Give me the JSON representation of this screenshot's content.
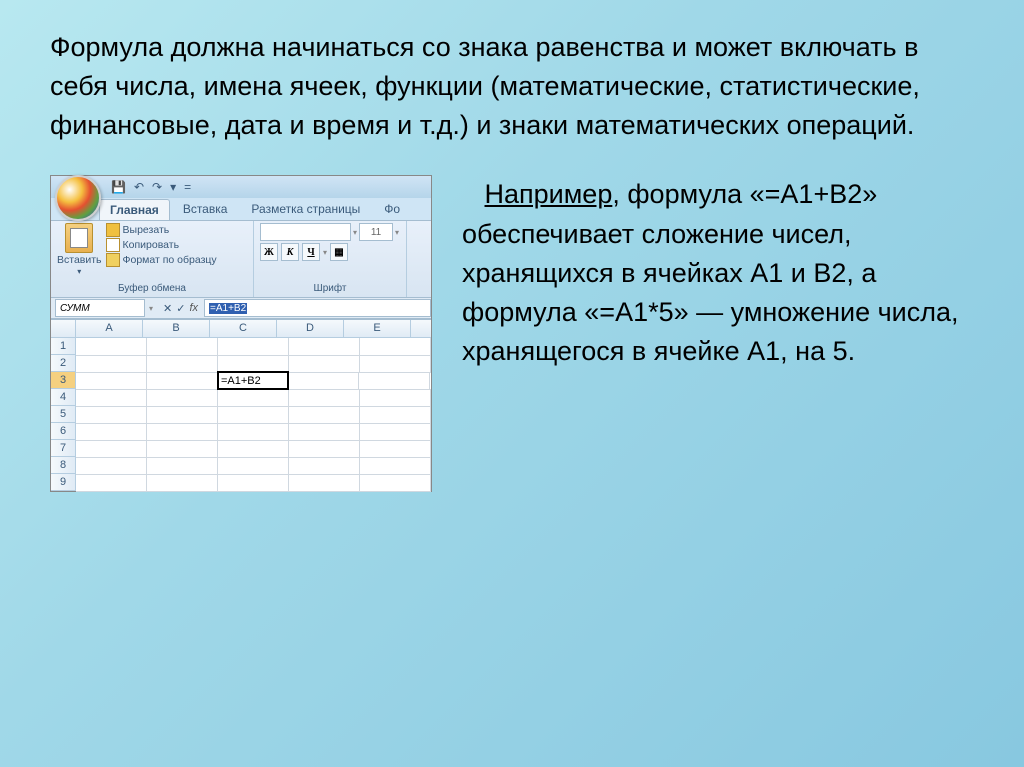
{
  "main_paragraph": "Формула должна начинаться со знака равенства и может включать в себя числа, имена ячеек, функции (математические, статистические, финансовые, дата и время и т.д.) и знаки математических операций.",
  "body_lead": "Например",
  "body_paragraph": ", формула «=A1+B2» обеспечивает сложение чисел, хранящихся в ячейках A1 и B2, а формула «=A1*5» — умножение числа, хранящегося в ячейке A1, на 5.",
  "excel": {
    "qat": {
      "save": "💾",
      "undo": "↶",
      "redo": "↷",
      "dd": "▾",
      "eq": "="
    },
    "tabs": [
      "Главная",
      "Вставка",
      "Разметка страницы",
      "Фо"
    ],
    "paste_label": "Вставить",
    "clip": {
      "cut": "Вырезать",
      "copy": "Копировать",
      "brush": "Формат по образцу"
    },
    "clipboard_label": "Буфер обмена",
    "font": {
      "size": "11",
      "label": "Шрифт",
      "b": "Ж",
      "i": "К",
      "u": "Ч"
    },
    "namebox": "СУММ",
    "fx": {
      "x": "✕",
      "v": "✓",
      "label": "fx"
    },
    "formula": "=A1+B2",
    "cols": [
      "A",
      "B",
      "C",
      "D",
      "E"
    ],
    "rows": [
      "1",
      "2",
      "3",
      "4",
      "5",
      "6",
      "7",
      "8",
      "9"
    ],
    "active_cell_value": "=A1+B2"
  }
}
